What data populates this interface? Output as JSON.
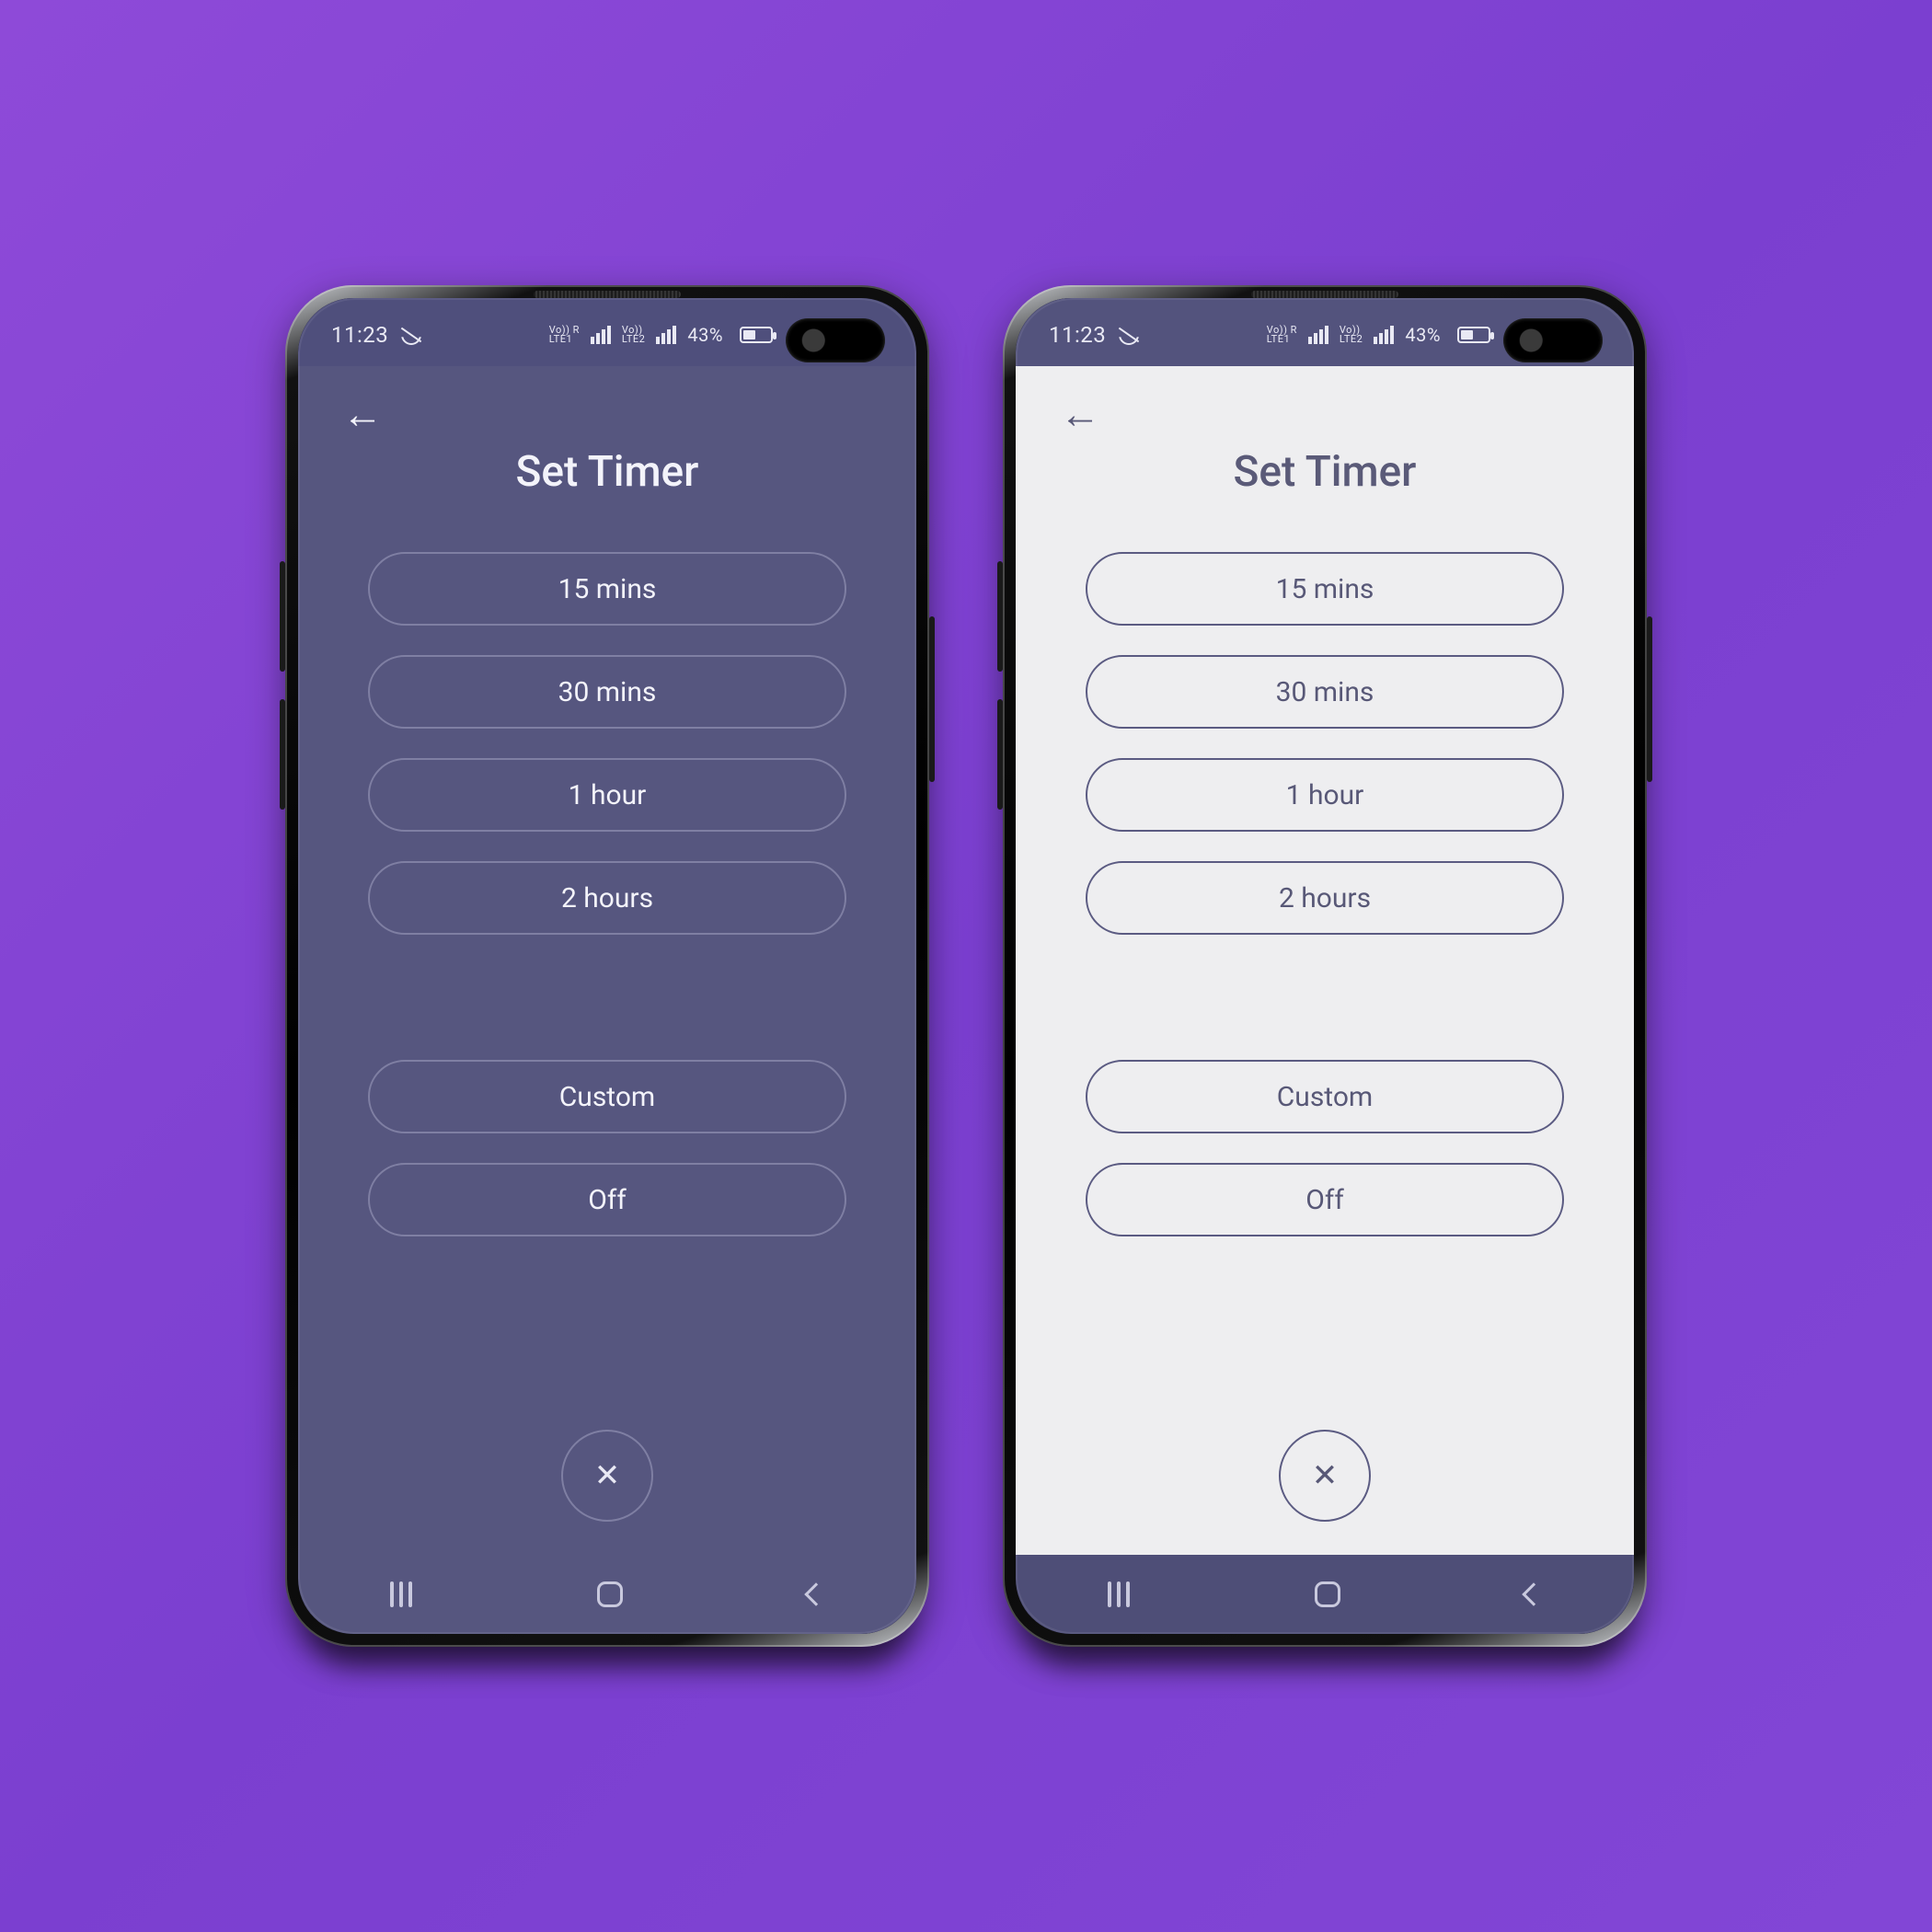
{
  "status": {
    "time": "11:23",
    "lte1": "Vo)) R\nLTE1",
    "lte2": "Vo))\nLTE2",
    "battery": "43%"
  },
  "app": {
    "title": "Set Timer",
    "options": [
      "15 mins",
      "30 mins",
      "1 hour",
      "2 hours"
    ],
    "extra": [
      "Custom",
      "Off"
    ]
  },
  "colors": {
    "dark_bg": "#56567f",
    "light_bg": "#eeeef0",
    "accent": "#5b5b82"
  }
}
